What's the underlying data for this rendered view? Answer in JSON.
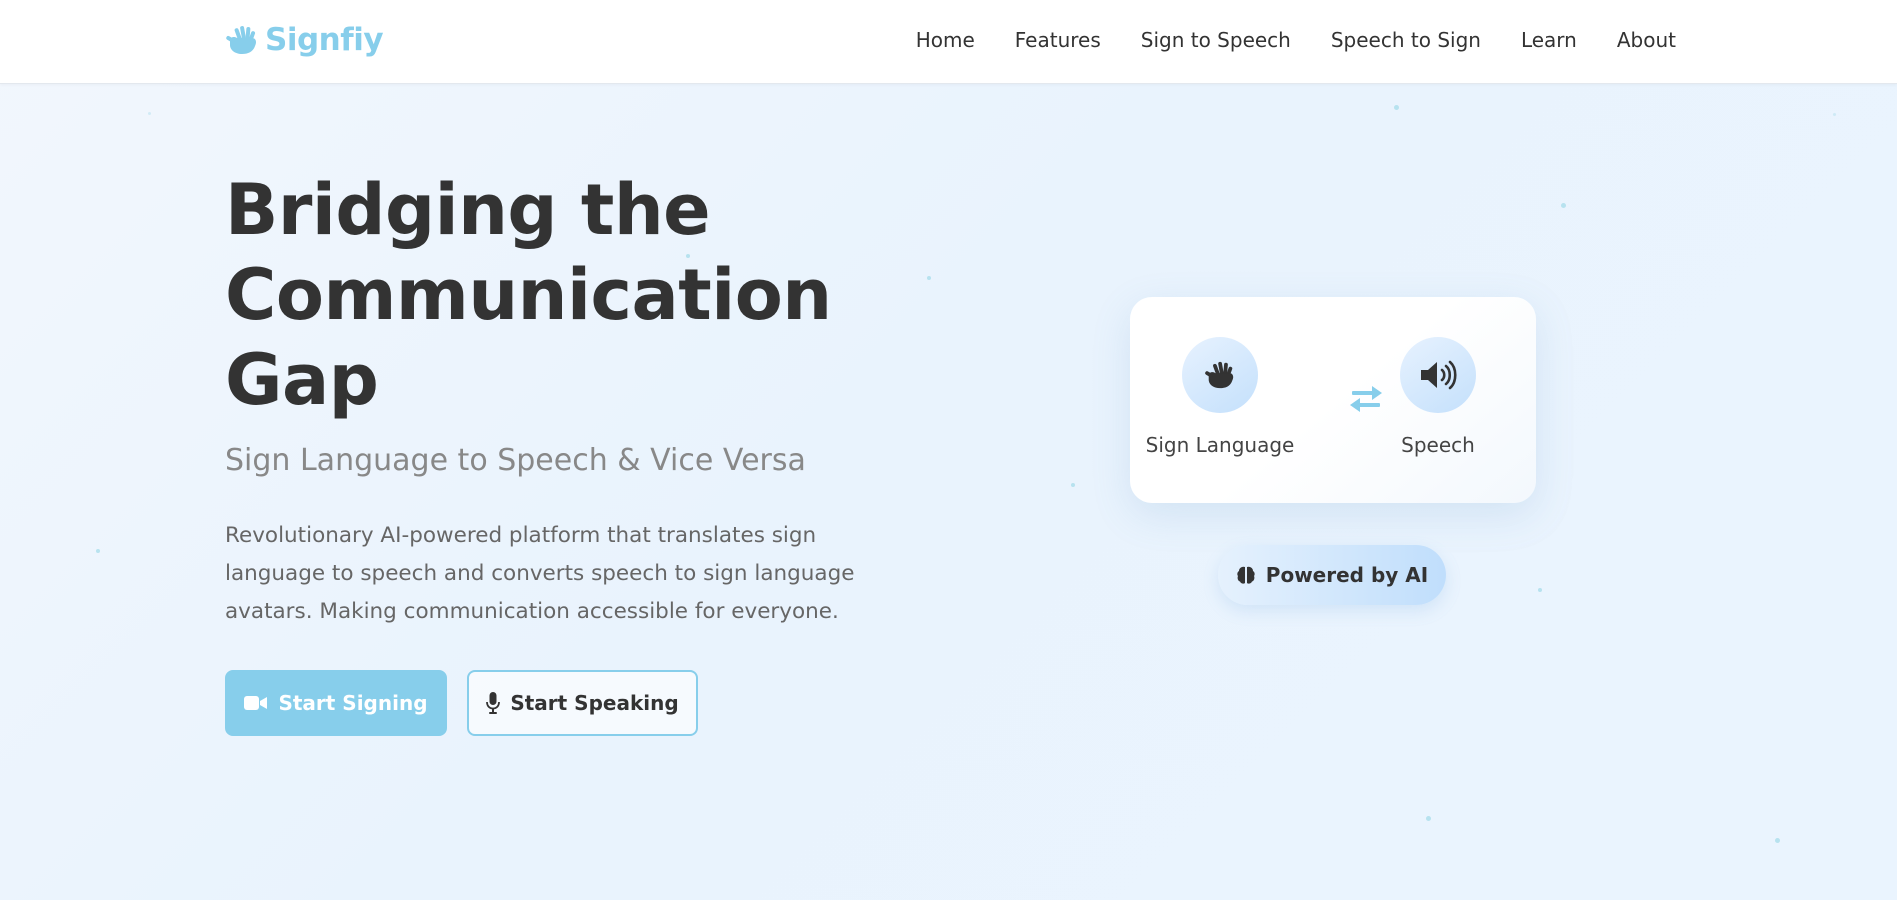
{
  "nav": {
    "brand": "Signfiy",
    "links": [
      "Home",
      "Features",
      "Sign to Speech",
      "Speech to Sign",
      "Learn",
      "About"
    ]
  },
  "hero": {
    "title": "Bridging the Communication Gap",
    "subtitle": "Sign Language to Speech & Vice Versa",
    "description": "Revolutionary AI-powered platform that translates sign language to speech and converts speech to sign language avatars. Making communication accessible for everyone.",
    "primary_button": "Start Signing",
    "secondary_button": "Start Speaking"
  },
  "translate_card": {
    "left_label": "Sign Language",
    "right_label": "Speech"
  },
  "ai_badge": "Powered by AI",
  "colors": {
    "accent": "#87ceeb",
    "text": "#333333",
    "muted": "#888888",
    "background": "#eaf3fd"
  },
  "icons": {
    "logo": "hands-signing-icon",
    "sign": "hands-signing-icon",
    "speech": "volume-high-icon",
    "exchange": "arrow-right-arrow-left-icon",
    "brain": "brain-icon",
    "video": "video-camera-icon",
    "mic": "microphone-icon"
  }
}
